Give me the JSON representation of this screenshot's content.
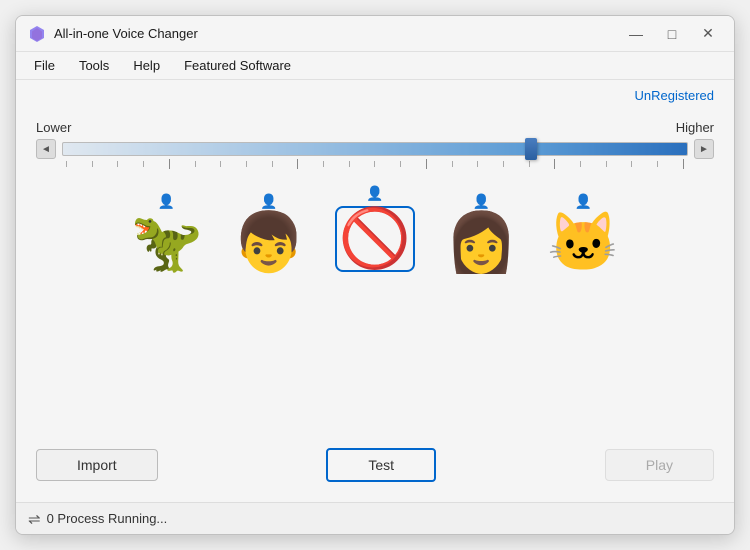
{
  "window": {
    "title": "All-in-one Voice Changer",
    "controls": {
      "minimize": "—",
      "maximize": "□",
      "close": "✕"
    }
  },
  "menu": {
    "items": [
      "File",
      "Tools",
      "Help",
      "Featured Software"
    ]
  },
  "header": {
    "unregistered_label": "UnRegistered"
  },
  "slider": {
    "lower_label": "Lower",
    "higher_label": "Higher",
    "left_arrow": "◄",
    "right_arrow": "►"
  },
  "characters": [
    {
      "id": "dragon",
      "emoji": "🦕",
      "label": "Dragon"
    },
    {
      "id": "man",
      "emoji": "👨",
      "label": "Man"
    },
    {
      "id": "cancel",
      "emoji": "🚫",
      "label": "None"
    },
    {
      "id": "woman",
      "emoji": "👩",
      "label": "Woman"
    },
    {
      "id": "cat",
      "emoji": "🐱",
      "label": "Cat"
    }
  ],
  "buttons": {
    "import": "Import",
    "test": "Test",
    "play": "Play"
  },
  "status_bar": {
    "icon": "⇌",
    "text": "0 Process Running..."
  }
}
